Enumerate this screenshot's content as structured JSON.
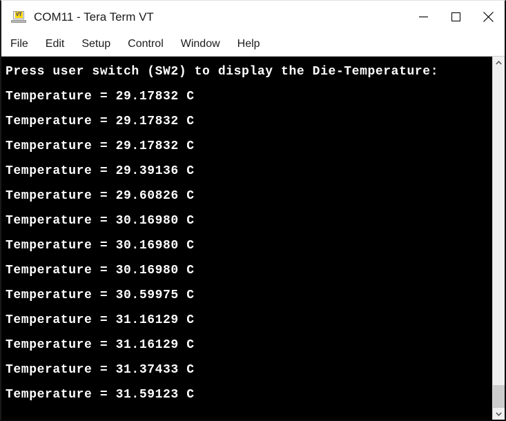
{
  "window": {
    "title": "COM11 - Tera Term VT",
    "icon": "terminal-vt-icon",
    "controls": {
      "minimize": "minimize",
      "maximize": "maximize",
      "close": "close"
    }
  },
  "menubar": {
    "items": [
      {
        "label": "File"
      },
      {
        "label": "Edit"
      },
      {
        "label": "Setup"
      },
      {
        "label": "Control"
      },
      {
        "label": "Window"
      },
      {
        "label": "Help"
      }
    ]
  },
  "terminal": {
    "background_color": "#000000",
    "text_color": "#ffffff",
    "lines": [
      "Press user switch (SW2) to display the Die-Temperature:",
      "Temperature = 29.17832 C",
      "Temperature = 29.17832 C",
      "Temperature = 29.17832 C",
      "Temperature = 29.39136 C",
      "Temperature = 29.60826 C",
      "Temperature = 30.16980 C",
      "Temperature = 30.16980 C",
      "Temperature = 30.16980 C",
      "Temperature = 30.59975 C",
      "Temperature = 31.16129 C",
      "Temperature = 31.16129 C",
      "Temperature = 31.37433 C",
      "Temperature = 31.59123 C"
    ]
  },
  "scrollbar": {
    "up_arrow": "scroll-up",
    "down_arrow": "scroll-down",
    "thumb_color": "#cdcdcd",
    "position": "bottom"
  }
}
